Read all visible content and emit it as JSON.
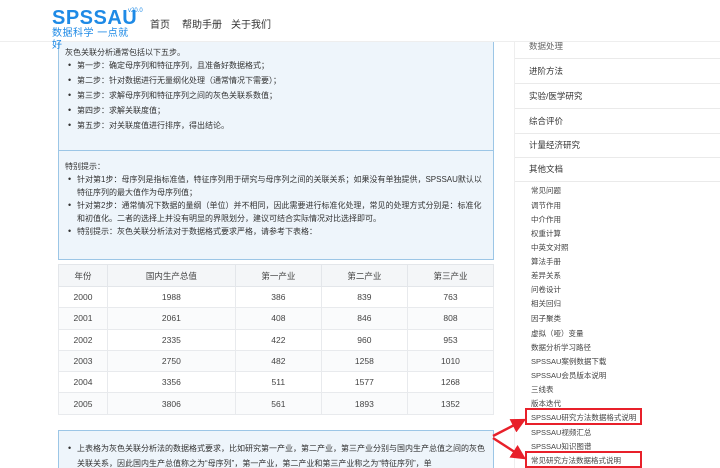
{
  "header": {
    "logo_text": "SPSSAU",
    "logo_version": "v20.0",
    "logo_subtitle": "数据科学 一点就好",
    "nav": [
      "首页",
      "帮助手册",
      "关于我们"
    ]
  },
  "steps_box": {
    "intro": "灰色关联分析通常包括以下五步。",
    "items": [
      "第一步：确定母序列和特征序列，且准备好数据格式；",
      "第二步：针对数据进行无量纲化处理（通常情况下需要）；",
      "第三步：求解母序列和特征序列之间的灰色关联系数值；",
      "第四步：求解关联度值；",
      "第五步：对关联度值进行排序，得出结论。"
    ]
  },
  "tips_box": {
    "intro": "特别提示：",
    "items": [
      "针对第1步：母序列是指标准值，特征序列用于研究与母序列之间的关联关系；如果没有单独提供，SPSSAU默认以特征序列的最大值作为母序列值；",
      "针对第2步：通常情况下数据的量纲（单位）并不相同，因此需要进行标准化处理，常见的处理方式分别是：标准化和初值化。二者的选择上并没有明显的界限划分，建议可结合实际情况对比选择即可。",
      "特别提示：灰色关联分析法对于数据格式要求严格，请参考下表格："
    ]
  },
  "table": {
    "headers": [
      "年份",
      "国内生产总值",
      "第一产业",
      "第二产业",
      "第三产业"
    ],
    "rows": [
      [
        "2000",
        "1988",
        "386",
        "839",
        "763"
      ],
      [
        "2001",
        "2061",
        "408",
        "846",
        "808"
      ],
      [
        "2002",
        "2335",
        "422",
        "960",
        "953"
      ],
      [
        "2003",
        "2750",
        "482",
        "1258",
        "1010"
      ],
      [
        "2004",
        "3356",
        "511",
        "1577",
        "1268"
      ],
      [
        "2005",
        "3806",
        "561",
        "1893",
        "1352"
      ]
    ]
  },
  "bottom_box": {
    "items": [
      "上表格为灰色关联分析法的数据格式要求，比如研究第一产业，第二产业，第三产业分别与国内生产总值之间的灰色关联关系，因此国内生产总值称之为“母序列”，第一产业，第二产业和第三产业称之为“特征序列”，单"
    ]
  },
  "sidebar": {
    "categories": [
      "数据处理",
      "进阶方法",
      "实验/医学研究",
      "综合评价",
      "计量经济研究",
      "其他文档"
    ],
    "links": [
      "常见问题",
      "调节作用",
      "中介作用",
      "权重计算",
      "中英文对照",
      "算法手册",
      "差异关系",
      "问卷设计",
      "相关回归",
      "因子聚类",
      "虚拟（哑）变量",
      "数据分析学习路径",
      "SPSSAU案例数据下载",
      "SPSSAU会员版本说明",
      "三线表",
      "版本迭代",
      "SPSSAU研究方法数据格式说明",
      "SPSSAU视频汇总",
      "SPSSAU知识图谱",
      "常见研究方法数据格式说明"
    ]
  },
  "colors": {
    "brand": "#1e8ae6",
    "box_bg": "#eef5fb",
    "box_border": "#9cc6e6",
    "highlight": "#e8202a"
  }
}
